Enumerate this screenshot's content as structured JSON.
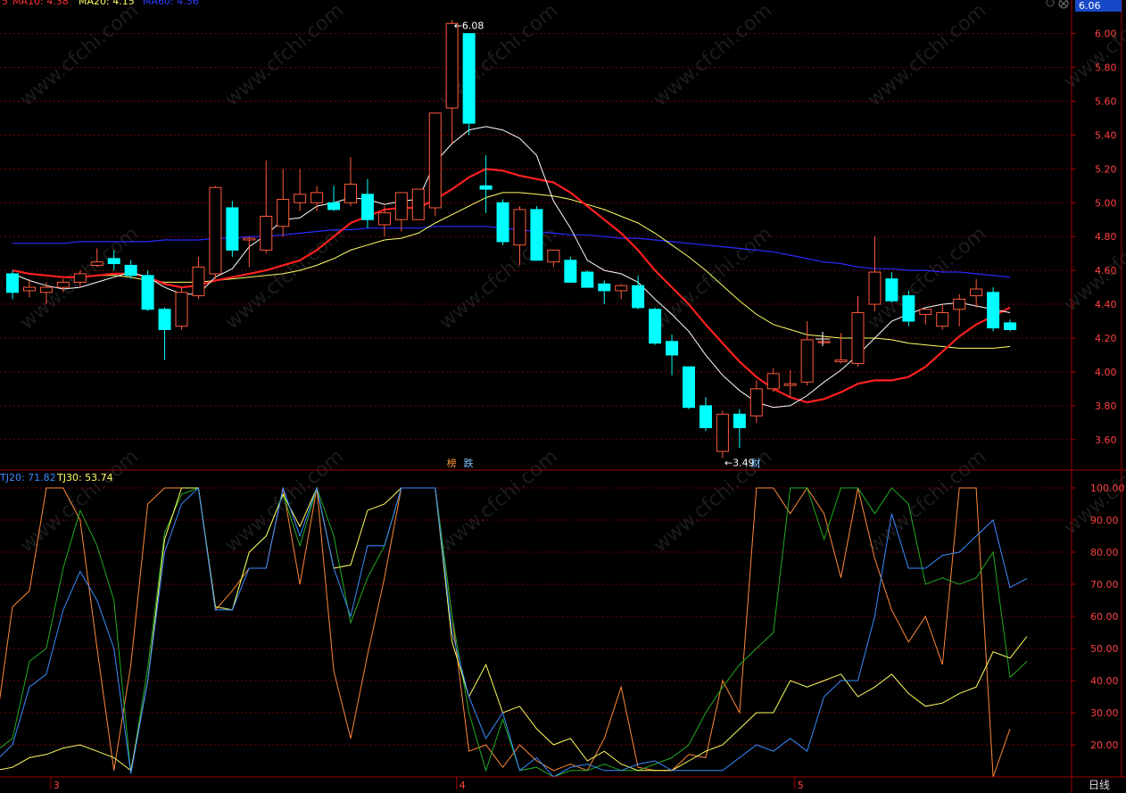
{
  "header": {
    "main_legend_prefix": "5",
    "ma_items": [
      {
        "label": "MA10: 4.38",
        "color": "#ff3030"
      },
      {
        "label": "MA20: 4.15",
        "color": "#ffff60"
      },
      {
        "label": "MA60: 4.56",
        "color": "#3040ff"
      }
    ],
    "current_price": "6.06",
    "sub_legend": [
      {
        "label": "TJ20: 71.82",
        "color": "#3a8cff"
      },
      {
        "label": "TJ30: 53.74",
        "color": "#ffff60"
      }
    ]
  },
  "colors": {
    "up": "#ff5a3c",
    "down": "#00ffff",
    "ma5": "#ffffff",
    "ma10": "#ff2020",
    "ma20": "#ffff66",
    "ma60": "#2a2aff",
    "grid": "#7a0000",
    "axis": "#a00000",
    "tick_text": "#ff4040"
  },
  "watermark": "www.cfchi.com",
  "period_label": "日线",
  "chart_data": [
    {
      "type": "candlestick",
      "name": "price",
      "ylim": [
        3.43,
        6.13
      ],
      "y_ticks": [
        "6.00",
        "5.80",
        "5.60",
        "5.40",
        "5.20",
        "5.00",
        "4.80",
        "4.60",
        "4.40",
        "4.20",
        "4.00",
        "3.80",
        "3.60"
      ],
      "annotations": {
        "high": "6.08",
        "low": "3.49"
      },
      "markers": [
        {
          "index": 26,
          "text": "榜",
          "color": "#ff9a3a"
        },
        {
          "index": 27,
          "text": "跌",
          "color": "#7ec8ff"
        },
        {
          "index": 44,
          "text": "财",
          "color": "#7ec8ff"
        }
      ],
      "candles": [
        {
          "o": 4.58,
          "h": 4.6,
          "l": 4.43,
          "c": 4.47
        },
        {
          "o": 4.48,
          "h": 4.55,
          "l": 4.44,
          "c": 4.5
        },
        {
          "o": 4.47,
          "h": 4.53,
          "l": 4.4,
          "c": 4.5
        },
        {
          "o": 4.5,
          "h": 4.55,
          "l": 4.47,
          "c": 4.53
        },
        {
          "o": 4.53,
          "h": 4.6,
          "l": 4.5,
          "c": 4.58
        },
        {
          "o": 4.63,
          "h": 4.73,
          "l": 4.62,
          "c": 4.65
        },
        {
          "o": 4.67,
          "h": 4.72,
          "l": 4.6,
          "c": 4.64
        },
        {
          "o": 4.63,
          "h": 4.66,
          "l": 4.55,
          "c": 4.57
        },
        {
          "o": 4.57,
          "h": 4.6,
          "l": 4.36,
          "c": 4.37
        },
        {
          "o": 4.37,
          "h": 4.38,
          "l": 4.07,
          "c": 4.25
        },
        {
          "o": 4.27,
          "h": 4.5,
          "l": 4.25,
          "c": 4.47
        },
        {
          "o": 4.45,
          "h": 4.68,
          "l": 4.43,
          "c": 4.62
        },
        {
          "o": 4.58,
          "h": 5.1,
          "l": 4.55,
          "c": 5.09
        },
        {
          "o": 4.97,
          "h": 5.01,
          "l": 4.68,
          "c": 4.72
        },
        {
          "o": 4.78,
          "h": 4.8,
          "l": 4.62,
          "c": 4.79
        },
        {
          "o": 4.72,
          "h": 5.25,
          "l": 4.7,
          "c": 4.92
        },
        {
          "o": 4.86,
          "h": 5.2,
          "l": 4.8,
          "c": 5.02
        },
        {
          "o": 5.0,
          "h": 5.2,
          "l": 4.95,
          "c": 5.05
        },
        {
          "o": 5.0,
          "h": 5.1,
          "l": 4.95,
          "c": 5.06
        },
        {
          "o": 5.0,
          "h": 5.1,
          "l": 4.95,
          "c": 4.96
        },
        {
          "o": 5.0,
          "h": 5.27,
          "l": 4.98,
          "c": 5.11
        },
        {
          "o": 5.05,
          "h": 5.14,
          "l": 4.85,
          "c": 4.9
        },
        {
          "o": 4.87,
          "h": 4.98,
          "l": 4.8,
          "c": 4.94
        },
        {
          "o": 4.9,
          "h": 5.03,
          "l": 4.83,
          "c": 5.06
        },
        {
          "o": 4.9,
          "h": 5.06,
          "l": 4.95,
          "c": 5.08
        },
        {
          "o": 4.97,
          "h": 5.05,
          "l": 4.92,
          "c": 5.53
        },
        {
          "o": 5.56,
          "h": 6.08,
          "l": 5.35,
          "c": 6.06
        },
        {
          "o": 6.0,
          "h": 6.0,
          "l": 5.4,
          "c": 5.47
        },
        {
          "o": 5.1,
          "h": 5.28,
          "l": 4.94,
          "c": 5.08
        },
        {
          "o": 5.0,
          "h": 5.02,
          "l": 4.75,
          "c": 4.77
        },
        {
          "o": 4.75,
          "h": 4.98,
          "l": 4.63,
          "c": 4.96
        },
        {
          "o": 4.96,
          "h": 4.98,
          "l": 4.66,
          "c": 4.66
        },
        {
          "o": 4.65,
          "h": 4.72,
          "l": 4.62,
          "c": 4.72
        },
        {
          "o": 4.66,
          "h": 4.68,
          "l": 4.53,
          "c": 4.53
        },
        {
          "o": 4.59,
          "h": 4.6,
          "l": 4.5,
          "c": 4.5
        },
        {
          "o": 4.52,
          "h": 4.54,
          "l": 4.4,
          "c": 4.48
        },
        {
          "o": 4.48,
          "h": 4.52,
          "l": 4.43,
          "c": 4.51
        },
        {
          "o": 4.51,
          "h": 4.57,
          "l": 4.37,
          "c": 4.38
        },
        {
          "o": 4.37,
          "h": 4.38,
          "l": 4.16,
          "c": 4.17
        },
        {
          "o": 4.18,
          "h": 4.22,
          "l": 3.98,
          "c": 4.1
        },
        {
          "o": 4.03,
          "h": 4.03,
          "l": 3.78,
          "c": 3.79
        },
        {
          "o": 3.8,
          "h": 3.85,
          "l": 3.65,
          "c": 3.67
        },
        {
          "o": 3.53,
          "h": 3.77,
          "l": 3.49,
          "c": 3.75
        },
        {
          "o": 3.75,
          "h": 3.78,
          "l": 3.55,
          "c": 3.67
        },
        {
          "o": 3.74,
          "h": 3.95,
          "l": 3.7,
          "c": 3.9
        },
        {
          "o": 3.9,
          "h": 4.02,
          "l": 3.88,
          "c": 3.99
        },
        {
          "o": 3.92,
          "h": 4.01,
          "l": 3.85,
          "c": 3.93
        },
        {
          "o": 3.94,
          "h": 4.3,
          "l": 3.92,
          "c": 4.19
        },
        {
          "o": 4.18,
          "h": 4.18,
          "l": 4.18,
          "c": 4.18
        },
        {
          "o": 4.06,
          "h": 4.23,
          "l": 4.05,
          "c": 4.07
        },
        {
          "o": 4.05,
          "h": 4.45,
          "l": 4.03,
          "c": 4.35
        },
        {
          "o": 4.4,
          "h": 4.8,
          "l": 4.36,
          "c": 4.59
        },
        {
          "o": 4.55,
          "h": 4.59,
          "l": 4.41,
          "c": 4.42
        },
        {
          "o": 4.45,
          "h": 4.48,
          "l": 4.27,
          "c": 4.3
        },
        {
          "o": 4.34,
          "h": 4.37,
          "l": 4.28,
          "c": 4.37
        },
        {
          "o": 4.27,
          "h": 4.4,
          "l": 4.25,
          "c": 4.35
        },
        {
          "o": 4.37,
          "h": 4.46,
          "l": 4.27,
          "c": 4.43
        },
        {
          "o": 4.45,
          "h": 4.55,
          "l": 4.38,
          "c": 4.49
        },
        {
          "o": 4.47,
          "h": 4.5,
          "l": 4.24,
          "c": 4.26
        },
        {
          "o": 4.29,
          "h": 4.31,
          "l": 4.24,
          "c": 4.25
        }
      ],
      "ma5": [
        4.58,
        4.54,
        4.51,
        4.49,
        4.5,
        4.53,
        4.56,
        4.59,
        4.56,
        4.5,
        4.46,
        4.46,
        4.56,
        4.61,
        4.74,
        4.81,
        4.9,
        4.91,
        4.98,
        5.0,
        5.03,
        5.02,
        4.99,
        5.01,
        5.02,
        5.24,
        5.35,
        5.43,
        5.45,
        5.43,
        5.38,
        5.28,
        5.01,
        4.85,
        4.66,
        4.6,
        4.58,
        4.53,
        4.43,
        4.34,
        4.24,
        4.1,
        3.98,
        3.89,
        3.82,
        3.79,
        3.8,
        3.86,
        3.94,
        4.01,
        4.1,
        4.2,
        4.3,
        4.34,
        4.38,
        4.4,
        4.41,
        4.39,
        4.37,
        4.35
      ],
      "ma10": [
        4.6,
        4.58,
        4.57,
        4.56,
        4.56,
        4.57,
        4.58,
        4.58,
        4.56,
        4.52,
        4.5,
        4.51,
        4.54,
        4.56,
        4.58,
        4.6,
        4.63,
        4.66,
        4.72,
        4.8,
        4.88,
        4.92,
        4.96,
        4.97,
        4.97,
        5.02,
        5.08,
        5.15,
        5.2,
        5.19,
        5.16,
        5.14,
        5.12,
        5.06,
        4.98,
        4.9,
        4.82,
        4.72,
        4.6,
        4.5,
        4.4,
        4.28,
        4.17,
        4.06,
        3.97,
        3.9,
        3.85,
        3.82,
        3.84,
        3.88,
        3.93,
        3.95,
        3.95,
        3.97,
        4.03,
        4.12,
        4.21,
        4.28,
        4.33,
        4.38
      ],
      "ma20": [
        4.6,
        4.58,
        4.57,
        4.56,
        4.56,
        4.57,
        4.57,
        4.56,
        4.54,
        4.53,
        4.53,
        4.53,
        4.54,
        4.55,
        4.56,
        4.57,
        4.58,
        4.6,
        4.63,
        4.67,
        4.72,
        4.75,
        4.78,
        4.79,
        4.82,
        4.88,
        4.93,
        4.98,
        5.03,
        5.06,
        5.06,
        5.05,
        5.04,
        5.02,
        4.99,
        4.96,
        4.92,
        4.88,
        4.82,
        4.75,
        4.68,
        4.6,
        4.51,
        4.42,
        4.34,
        4.28,
        4.25,
        4.22,
        4.21,
        4.2,
        4.2,
        4.2,
        4.19,
        4.17,
        4.16,
        4.15,
        4.14,
        4.14,
        4.14,
        4.15
      ],
      "ma60": [
        4.76,
        4.76,
        4.76,
        4.76,
        4.77,
        4.77,
        4.77,
        4.77,
        4.77,
        4.78,
        4.78,
        4.78,
        4.79,
        4.79,
        4.8,
        4.8,
        4.81,
        4.82,
        4.83,
        4.84,
        4.84,
        4.85,
        4.85,
        4.85,
        4.85,
        4.86,
        4.86,
        4.86,
        4.86,
        4.85,
        4.84,
        4.83,
        4.82,
        4.81,
        4.81,
        4.8,
        4.79,
        4.79,
        4.78,
        4.77,
        4.76,
        4.75,
        4.74,
        4.73,
        4.72,
        4.71,
        4.69,
        4.67,
        4.65,
        4.64,
        4.62,
        4.61,
        4.61,
        4.6,
        4.6,
        4.59,
        4.59,
        4.58,
        4.57,
        4.56
      ]
    },
    {
      "type": "line",
      "name": "indicator",
      "ylim": [
        10,
        105
      ],
      "y_ticks": [
        "100.00",
        "90.00",
        "80.00",
        "70.00",
        "60.00",
        "50.00",
        "40.00",
        "30.00",
        "20.00"
      ],
      "x_labels": [
        {
          "index": 2,
          "text": "3"
        },
        {
          "index": 26,
          "text": "4"
        },
        {
          "index": 46,
          "text": "5"
        }
      ],
      "series": [
        {
          "name": "TJ20",
          "color": "#3a8cff",
          "values": [
            15,
            20,
            38,
            42,
            62,
            74,
            65,
            50,
            11,
            40,
            80,
            95,
            100,
            62,
            62,
            75,
            75,
            100,
            85,
            100,
            75,
            60,
            82,
            82,
            100,
            100,
            100,
            55,
            35,
            22,
            30,
            12,
            16,
            10,
            13,
            14,
            12,
            12,
            14,
            15,
            12,
            12,
            12,
            12,
            16,
            20,
            18,
            22,
            18,
            35,
            40,
            40,
            60,
            92,
            75,
            75,
            79,
            80,
            85,
            90,
            69,
            71.82
          ]
        },
        {
          "name": "TJ30",
          "color": "#ffff60",
          "values": [
            12,
            13,
            16,
            17,
            19,
            20,
            18,
            16,
            12,
            40,
            84,
            100,
            100,
            63,
            62,
            80,
            85,
            98,
            88,
            100,
            75,
            76,
            93,
            95,
            100,
            100,
            100,
            52,
            35,
            45,
            30,
            32,
            25,
            20,
            22,
            15,
            18,
            14,
            12,
            12,
            12,
            15,
            18,
            20,
            25,
            30,
            30,
            40,
            38,
            40,
            42,
            35,
            38,
            42,
            36,
            32,
            33,
            36,
            38,
            49,
            47,
            53.74
          ]
        },
        {
          "name": "",
          "color": "#22aa22",
          "values": [
            18,
            22,
            46,
            50,
            75,
            93,
            82,
            65,
            11,
            44,
            86,
            98,
            100,
            63,
            62,
            80,
            85,
            98,
            82,
            100,
            85,
            58,
            72,
            82,
            100,
            100,
            100,
            60,
            30,
            12,
            28,
            12,
            13,
            10,
            12,
            12,
            14,
            12,
            12,
            14,
            16,
            20,
            30,
            38,
            45,
            50,
            55,
            100,
            100,
            84,
            100,
            100,
            92,
            100,
            95,
            70,
            72,
            70,
            72,
            80,
            41,
            46
          ]
        },
        {
          "name": "",
          "color": "#ff8a3a",
          "values": [
            25,
            63,
            68,
            100,
            100,
            90,
            50,
            12,
            45,
            95,
            100,
            100,
            100,
            62,
            68,
            75,
            75,
            100,
            70,
            100,
            43,
            22,
            48,
            72,
            100,
            100,
            100,
            60,
            18,
            20,
            13,
            20,
            15,
            12,
            14,
            12,
            22,
            38,
            13,
            12,
            12,
            17,
            16,
            40,
            30,
            100,
            100,
            92,
            100,
            92,
            72,
            100,
            78,
            62,
            52,
            60,
            45,
            100,
            100,
            10,
            25
          ]
        }
      ]
    }
  ]
}
